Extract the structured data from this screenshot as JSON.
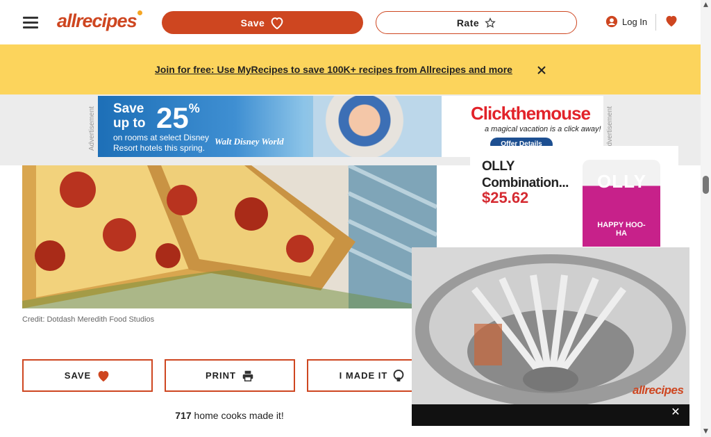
{
  "header": {
    "logo_text": "allrecipes",
    "save_label": "Save",
    "rate_label": "Rate",
    "login_label": "Log In"
  },
  "promo": {
    "link_text": "Join for free: Use MyRecipes to save 100K+ recipes from Allrecipes and more"
  },
  "top_ad": {
    "label": "Advertisement",
    "save_text": "Save up to",
    "percent": "25",
    "percent_sign": "%",
    "sub_text": "on rooms at select Disney Resort hotels this spring.",
    "disney_mark": "Walt Disney World",
    "brand": "Clickthemouse",
    "tagline": "a magical vacation is a click away!",
    "cta": "Offer Details"
  },
  "recipe": {
    "image_credit": "Credit: Dotdash Meredith Food Studios",
    "actions": [
      {
        "label": "SAVE"
      },
      {
        "label": "PRINT"
      },
      {
        "label": "I MADE IT"
      }
    ],
    "made_count": "717",
    "made_text": " home cooks made it!"
  },
  "side_ad": {
    "product_line1": "OLLY",
    "product_line2": "Combination...",
    "price": "$25.62",
    "bottle_brand": "OLLY",
    "bottle_name": "HAPPY HOO-HA"
  },
  "video": {
    "watermark": "allrecipes"
  },
  "colors": {
    "brand": "#ce4620",
    "promo_bg": "#fcd45c",
    "price": "#d52b32"
  }
}
